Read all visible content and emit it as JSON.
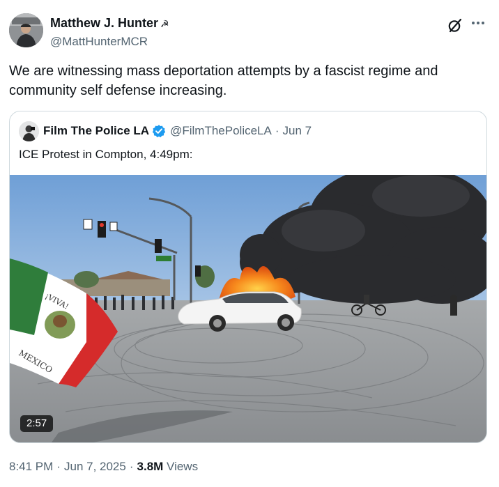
{
  "author": {
    "display_name": "Matthew J. Hunter",
    "name_emoji": "☭",
    "handle": "@MattHunterMCR"
  },
  "tweet": {
    "text": "We are witnessing mass deportation attempts by a fascist regime and community self defense increasing."
  },
  "quoted": {
    "display_name": "Film The Police LA",
    "handle": "@FilmThePoliceLA",
    "separator": "·",
    "date": "Jun 7",
    "text": "ICE Protest in Compton, 4:49pm:",
    "video_duration": "2:57"
  },
  "meta": {
    "time": "8:41 PM",
    "date": "Jun 7, 2025",
    "separator": "·",
    "views_count": "3.8M",
    "views_label": "Views"
  },
  "colors": {
    "text_primary": "#0f1419",
    "text_secondary": "#536471",
    "border": "#cfd9de",
    "verified_badge": "#1d9bf0"
  },
  "icons": {
    "grok": "grok-icon",
    "more": "more-icon",
    "verified": "verified-badge-icon"
  }
}
